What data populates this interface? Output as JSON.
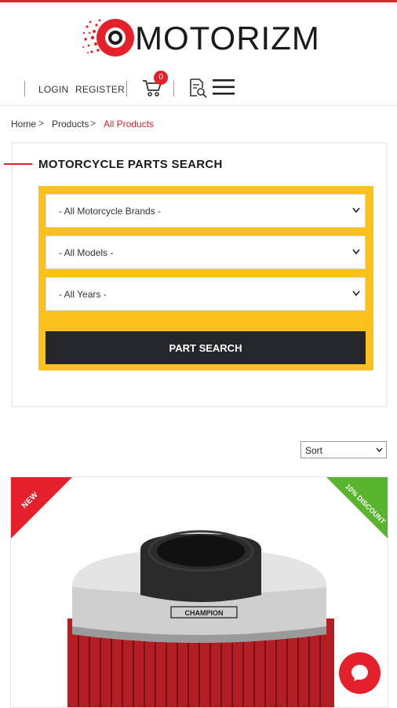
{
  "brand": {
    "logo_text": "MOTORIZM",
    "accent_color": "#e4202a"
  },
  "header": {
    "login_label": "LOGIN",
    "register_label": "REGISTER",
    "cart_count": "0",
    "icons": [
      "cart-icon",
      "search-document-icon",
      "hamburger-menu-icon"
    ]
  },
  "breadcrumb": {
    "items": [
      "Home",
      "Products",
      "All Products"
    ],
    "separator": ">"
  },
  "parts_search": {
    "title": "MOTORCYCLE PARTS SEARCH",
    "brand_select": "- All Motorcycle Brands -",
    "model_select": "- All Models -",
    "year_select": "- All Years -",
    "button_label": "PART SEARCH",
    "panel_color": "#fcc21b"
  },
  "listing": {
    "sort_label": "Sort",
    "product": {
      "badge_new": "NEW",
      "badge_discount": "10% DISCOUNT",
      "brand_print": "CHAMPION"
    }
  }
}
